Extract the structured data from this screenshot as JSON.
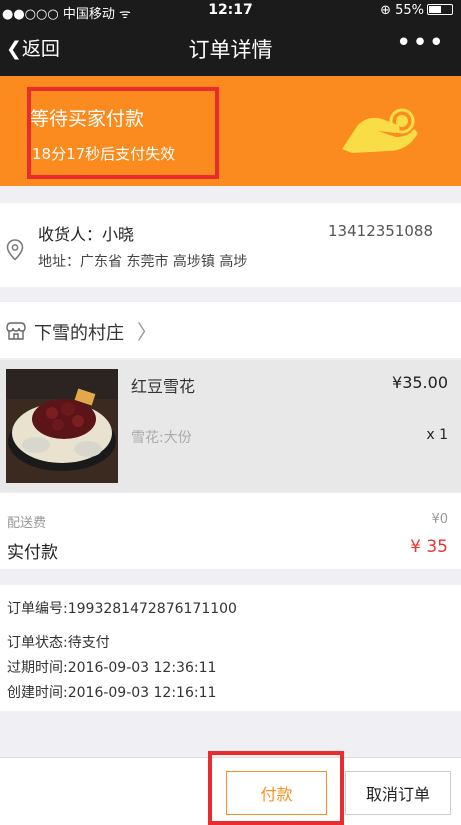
{
  "status_bar": {
    "signal": "●●○○○ 中国移动 ᯤ",
    "time": "12:17",
    "battery": "⊕ 55%"
  },
  "nav": {
    "back": "返回",
    "title": "订单详情",
    "more": "•••"
  },
  "banner": {
    "title": "等待买家付款",
    "countdown": "18分17秒后支付失效"
  },
  "address": {
    "name": "收货人：小晓",
    "phone": "13412351088",
    "detail": "地址：广东省 东莞市 高埗镇 高埗"
  },
  "shop": {
    "name": "下雪的村庄"
  },
  "product": {
    "name": "红豆雪花",
    "price": "¥35.00",
    "spec": "雪花:大份",
    "qty": "x 1"
  },
  "fees": {
    "delivery_label": "配送费",
    "delivery_value": "¥0",
    "total_label": "实付款",
    "total_value": "¥ 35"
  },
  "order_info": {
    "number": "订单编号:1993281472876171100",
    "status": "订单状态:待支付",
    "expire": "过期时间:2016-09-03 12:36:11",
    "created": "创建时间:2016-09-03 12:16:11"
  },
  "actions": {
    "pay": "付款",
    "cancel": "取消订单"
  },
  "colors": {
    "accent_orange": "#fb8b1f",
    "price_red": "#e8352f",
    "highlight_red": "#ea2c2c"
  }
}
